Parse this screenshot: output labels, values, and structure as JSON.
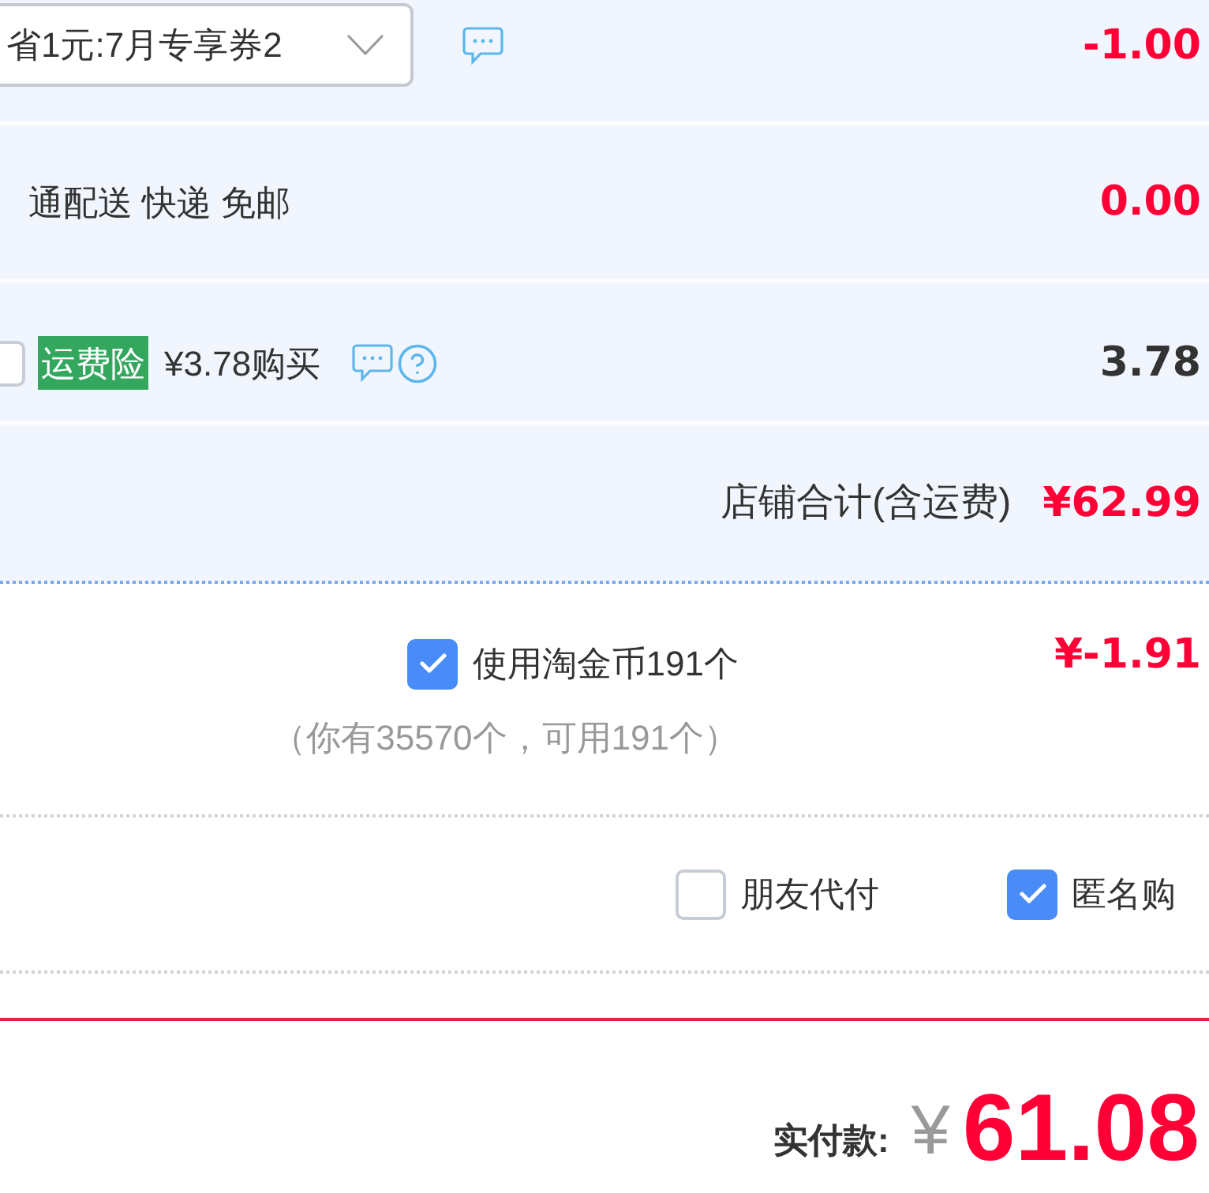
{
  "coupon": {
    "value": "省1元:7月专享券2",
    "amount": "-1.00"
  },
  "shipping": {
    "label": "通配送 快递 免邮",
    "amount": "0.00"
  },
  "insurance": {
    "checked": false,
    "tag": "运费险",
    "label": "¥3.78购买",
    "amount": "3.78"
  },
  "shop_total": {
    "label": "店铺合计(含运费)",
    "amount": "¥62.99"
  },
  "coins": {
    "checked": true,
    "label": "使用淘金币191个",
    "amount": "¥-1.91",
    "note": "（你有35570个，可用191个）"
  },
  "options": [
    {
      "label": "朋友代付",
      "checked": false
    },
    {
      "label": "匿名购",
      "checked": true
    }
  ],
  "payment": {
    "label": "实付款:",
    "currency": "¥",
    "amount": "61.08"
  }
}
